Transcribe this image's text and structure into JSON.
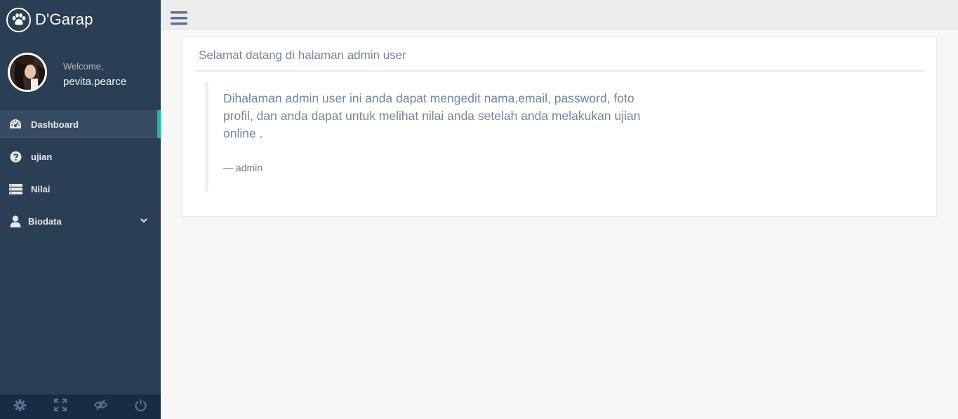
{
  "brand": {
    "title": "D'Garap",
    "icon": "paw-icon"
  },
  "profile": {
    "welcome": "Welcome,",
    "username": "pevita.pearce"
  },
  "nav": {
    "items": [
      {
        "label": "Dashboard",
        "icon": "dashboard-gauge-icon",
        "active": true
      },
      {
        "label": "ujian",
        "icon": "question-circle-icon"
      },
      {
        "label": "Nilai",
        "icon": "server-list-icon"
      },
      {
        "label": "Biodata",
        "icon": "user-icon",
        "has_submenu": true
      }
    ]
  },
  "footer_icons": [
    "settings-icon",
    "fullscreen-icon",
    "lock-eye-icon",
    "power-icon"
  ],
  "panel": {
    "title": "Selamat datang di halaman admin user",
    "quote_text": "Dihalaman admin user ini anda dapat mengedit nama,email, password, foto profil, dan anda dapat untuk melihat nilai anda setelah anda melakukan ujian online .",
    "quote_footer": "— admin"
  },
  "colors": {
    "sidebar_bg": "#2a3f54",
    "accent": "#1abb9c",
    "text_muted": "#73879c"
  }
}
